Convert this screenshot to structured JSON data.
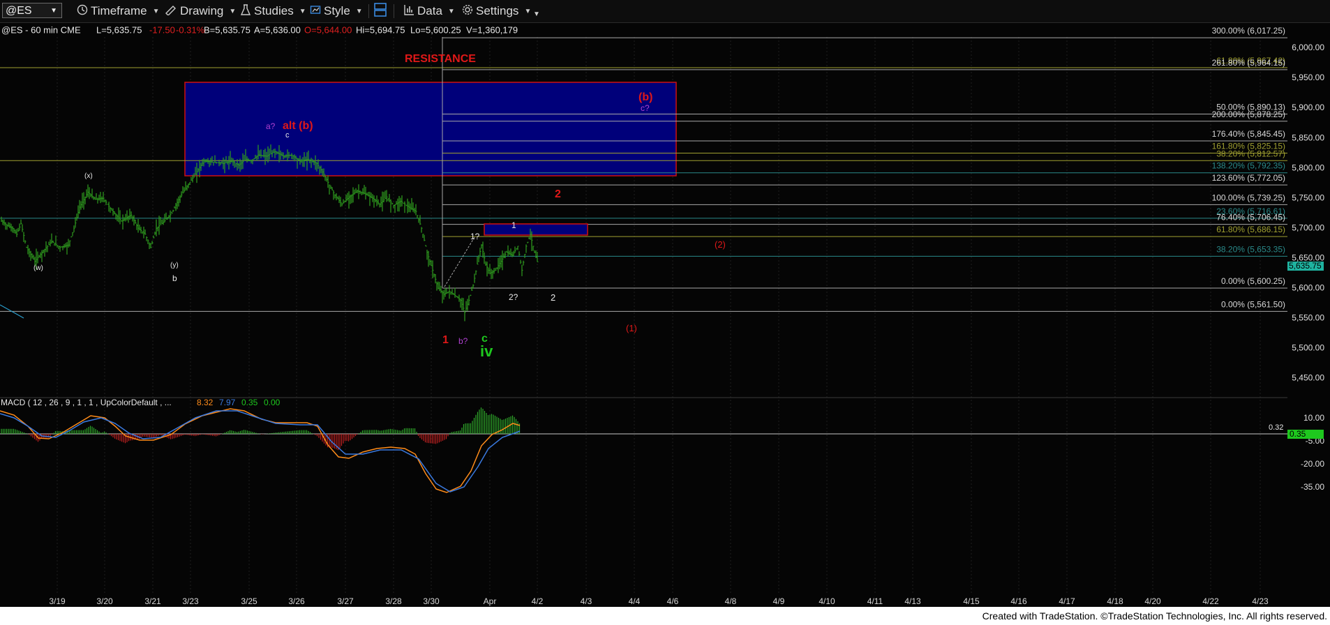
{
  "toolbar": {
    "symbol": "@ES",
    "timeframe": "Timeframe",
    "drawing": "Drawing",
    "studies": "Studies",
    "style": "Style",
    "data": "Data",
    "settings": "Settings"
  },
  "header": {
    "symbol_line": "@ES - 60 min  CME",
    "last": "L=5,635.75",
    "change": "-17.50",
    "pct": "-0.31%",
    "bid": "B=5,635.75",
    "ask": "A=5,636.00",
    "open": "O=5,644.00",
    "high": "Hi=5,694.75",
    "low": "Lo=5,600.25",
    "volume": "V=1,360,179"
  },
  "colors": {
    "up_bar": "#2e9e1e",
    "resistance_box": "#00007a",
    "resistance_border": "#d01010",
    "red_label": "#e01818",
    "purple_label": "#b040d0",
    "green_label": "#1ec81e",
    "white_fib": "#a8a8a8",
    "olive_fib": "#a0a030",
    "teal_fib": "#2a8a8a",
    "price_tag": "#1fb3a0",
    "macd_line": "#ff8c1a",
    "signal_line": "#3a7ae0"
  },
  "price_axis": {
    "labels": [
      "6,000.00",
      "5,950.00",
      "5,900.00",
      "5,850.00",
      "5,800.00",
      "5,750.00",
      "5,700.00",
      "5,650.00",
      "5,600.00",
      "5,550.00",
      "5,500.00",
      "5,450.00"
    ],
    "last_price": "5,635.75"
  },
  "fib_levels": [
    {
      "text": "300.00% (6,017.25)",
      "price": 6017.25,
      "color": "white"
    },
    {
      "text": "61.80% (5,967.42)",
      "price": 5967.42,
      "color": "olive"
    },
    {
      "text": "261.80% (5,964.15)",
      "price": 5964.15,
      "color": "white"
    },
    {
      "text": "50.00% (5,890.13)",
      "price": 5890.13,
      "color": "white"
    },
    {
      "text": "200.00% (5,878.25)",
      "price": 5878.25,
      "color": "white"
    },
    {
      "text": "176.40% (5,845.45)",
      "price": 5845.45,
      "color": "white"
    },
    {
      "text": "161.80% (5,825.15)",
      "price": 5825.15,
      "color": "olive"
    },
    {
      "text": "38.20% (5,812.57)",
      "price": 5812.57,
      "color": "olive"
    },
    {
      "text": "138.20% (5,792.35)",
      "price": 5792.35,
      "color": "teal"
    },
    {
      "text": "123.60% (5,772.05)",
      "price": 5772.05,
      "color": "white"
    },
    {
      "text": "100.00% (5,739.25)",
      "price": 5739.25,
      "color": "white"
    },
    {
      "text": "23.60% (5,716.61)",
      "price": 5716.61,
      "color": "teal"
    },
    {
      "text": "76.40% (5,706.45)",
      "price": 5706.45,
      "color": "white"
    },
    {
      "text": "61.80% (5,686.15)",
      "price": 5686.15,
      "color": "olive"
    },
    {
      "text": "38.20% (5,653.35)",
      "price": 5653.35,
      "color": "teal"
    },
    {
      "text": "0.00% (5,600.25)",
      "price": 5600.25,
      "color": "white"
    },
    {
      "text": "0.00% (5,561.50)",
      "price": 5561.5,
      "color": "white"
    }
  ],
  "annotations": {
    "resistance": "RESISTANCE",
    "b_paren": "(b)",
    "c_q_purple": "c?",
    "a_q": "a?",
    "alt_b": "alt (b)",
    "c_small": "c",
    "x_paren": "(x)",
    "w_paren": "(w)",
    "y_paren": "(y)",
    "b_small": "b",
    "two_red": "2",
    "one_white": "1",
    "one_q": "1?",
    "paren2": "(2)",
    "two_q": "2?",
    "two_white": "2",
    "paren1": "(1)",
    "one_red": "1",
    "b_q": "b?",
    "c_green": "c",
    "iv": "iv"
  },
  "macd": {
    "title": "MACD ( 12 , 26 , 9 , 1 , 1 , UpColorDefault , ...",
    "v1": "8.32",
    "v2": "7.97",
    "v3": "0.35",
    "v4": "0.00",
    "axis_labels": [
      "10.00",
      "-5.00",
      "-20.00",
      "-35.00"
    ],
    "zero_tag": "0.35",
    "level_label": "0.32"
  },
  "chart_data": {
    "type": "candlestick-bar",
    "title": "@ES - 60 min CME",
    "ylim": [
      5400,
      6030
    ],
    "dates": [
      "3/19",
      "3/20",
      "3/21",
      "3/23",
      "3/25",
      "3/26",
      "3/27",
      "3/28",
      "3/30",
      "Apr",
      "4/2",
      "4/3",
      "4/4",
      "4/6",
      "4/8",
      "4/9",
      "4/10",
      "4/11",
      "4/13",
      "4/15",
      "4/16",
      "4/17",
      "4/18",
      "4/20",
      "4/22",
      "4/23"
    ],
    "close_path": [
      {
        "t": 0,
        "p": 5712
      },
      {
        "t": 8,
        "p": 5705
      },
      {
        "t": 16,
        "p": 5700
      },
      {
        "t": 22,
        "p": 5690
      },
      {
        "t": 28,
        "p": 5708
      },
      {
        "t": 36,
        "p": 5668
      },
      {
        "t": 48,
        "p": 5645
      },
      {
        "t": 60,
        "p": 5662
      },
      {
        "t": 72,
        "p": 5678
      },
      {
        "t": 84,
        "p": 5668
      },
      {
        "t": 96,
        "p": 5672
      },
      {
        "t": 104,
        "p": 5700
      },
      {
        "t": 112,
        "p": 5735
      },
      {
        "t": 124,
        "p": 5760
      },
      {
        "t": 134,
        "p": 5748
      },
      {
        "t": 146,
        "p": 5750
      },
      {
        "t": 158,
        "p": 5730
      },
      {
        "t": 172,
        "p": 5712
      },
      {
        "t": 186,
        "p": 5722
      },
      {
        "t": 196,
        "p": 5700
      },
      {
        "t": 206,
        "p": 5690
      },
      {
        "t": 214,
        "p": 5668
      },
      {
        "t": 222,
        "p": 5700
      },
      {
        "t": 232,
        "p": 5710
      },
      {
        "t": 244,
        "p": 5725
      },
      {
        "t": 256,
        "p": 5752
      },
      {
        "t": 266,
        "p": 5770
      },
      {
        "t": 278,
        "p": 5790
      },
      {
        "t": 290,
        "p": 5812
      },
      {
        "t": 304,
        "p": 5810
      },
      {
        "t": 318,
        "p": 5808
      },
      {
        "t": 330,
        "p": 5812
      },
      {
        "t": 340,
        "p": 5805
      },
      {
        "t": 350,
        "p": 5815
      },
      {
        "t": 358,
        "p": 5812
      },
      {
        "t": 368,
        "p": 5822
      },
      {
        "t": 380,
        "p": 5820
      },
      {
        "t": 392,
        "p": 5828
      },
      {
        "t": 404,
        "p": 5820
      },
      {
        "t": 416,
        "p": 5822
      },
      {
        "t": 428,
        "p": 5812
      },
      {
        "t": 440,
        "p": 5815
      },
      {
        "t": 452,
        "p": 5808
      },
      {
        "t": 462,
        "p": 5790
      },
      {
        "t": 470,
        "p": 5772
      },
      {
        "t": 478,
        "p": 5755
      },
      {
        "t": 488,
        "p": 5740
      },
      {
        "t": 498,
        "p": 5752
      },
      {
        "t": 510,
        "p": 5762
      },
      {
        "t": 520,
        "p": 5758
      },
      {
        "t": 532,
        "p": 5750
      },
      {
        "t": 542,
        "p": 5740
      },
      {
        "t": 552,
        "p": 5752
      },
      {
        "t": 562,
        "p": 5738
      },
      {
        "t": 572,
        "p": 5745
      },
      {
        "t": 584,
        "p": 5735
      },
      {
        "t": 594,
        "p": 5728
      },
      {
        "t": 602,
        "p": 5700
      },
      {
        "t": 610,
        "p": 5660
      },
      {
        "t": 618,
        "p": 5630
      },
      {
        "t": 626,
        "p": 5600
      },
      {
        "t": 634,
        "p": 5590
      },
      {
        "t": 642,
        "p": 5595
      },
      {
        "t": 650,
        "p": 5588
      },
      {
        "t": 658,
        "p": 5580
      },
      {
        "t": 664,
        "p": 5560
      },
      {
        "t": 670,
        "p": 5580
      },
      {
        "t": 676,
        "p": 5605
      },
      {
        "t": 682,
        "p": 5640
      },
      {
        "t": 688,
        "p": 5672
      },
      {
        "t": 694,
        "p": 5640
      },
      {
        "t": 700,
        "p": 5625
      },
      {
        "t": 708,
        "p": 5630
      },
      {
        "t": 716,
        "p": 5645
      },
      {
        "t": 724,
        "p": 5660
      },
      {
        "t": 732,
        "p": 5655
      },
      {
        "t": 740,
        "p": 5670
      },
      {
        "t": 746,
        "p": 5630
      },
      {
        "t": 752,
        "p": 5670
      },
      {
        "t": 758,
        "p": 5690
      },
      {
        "t": 764,
        "p": 5660
      },
      {
        "t": 770,
        "p": 5636
      }
    ]
  }
}
